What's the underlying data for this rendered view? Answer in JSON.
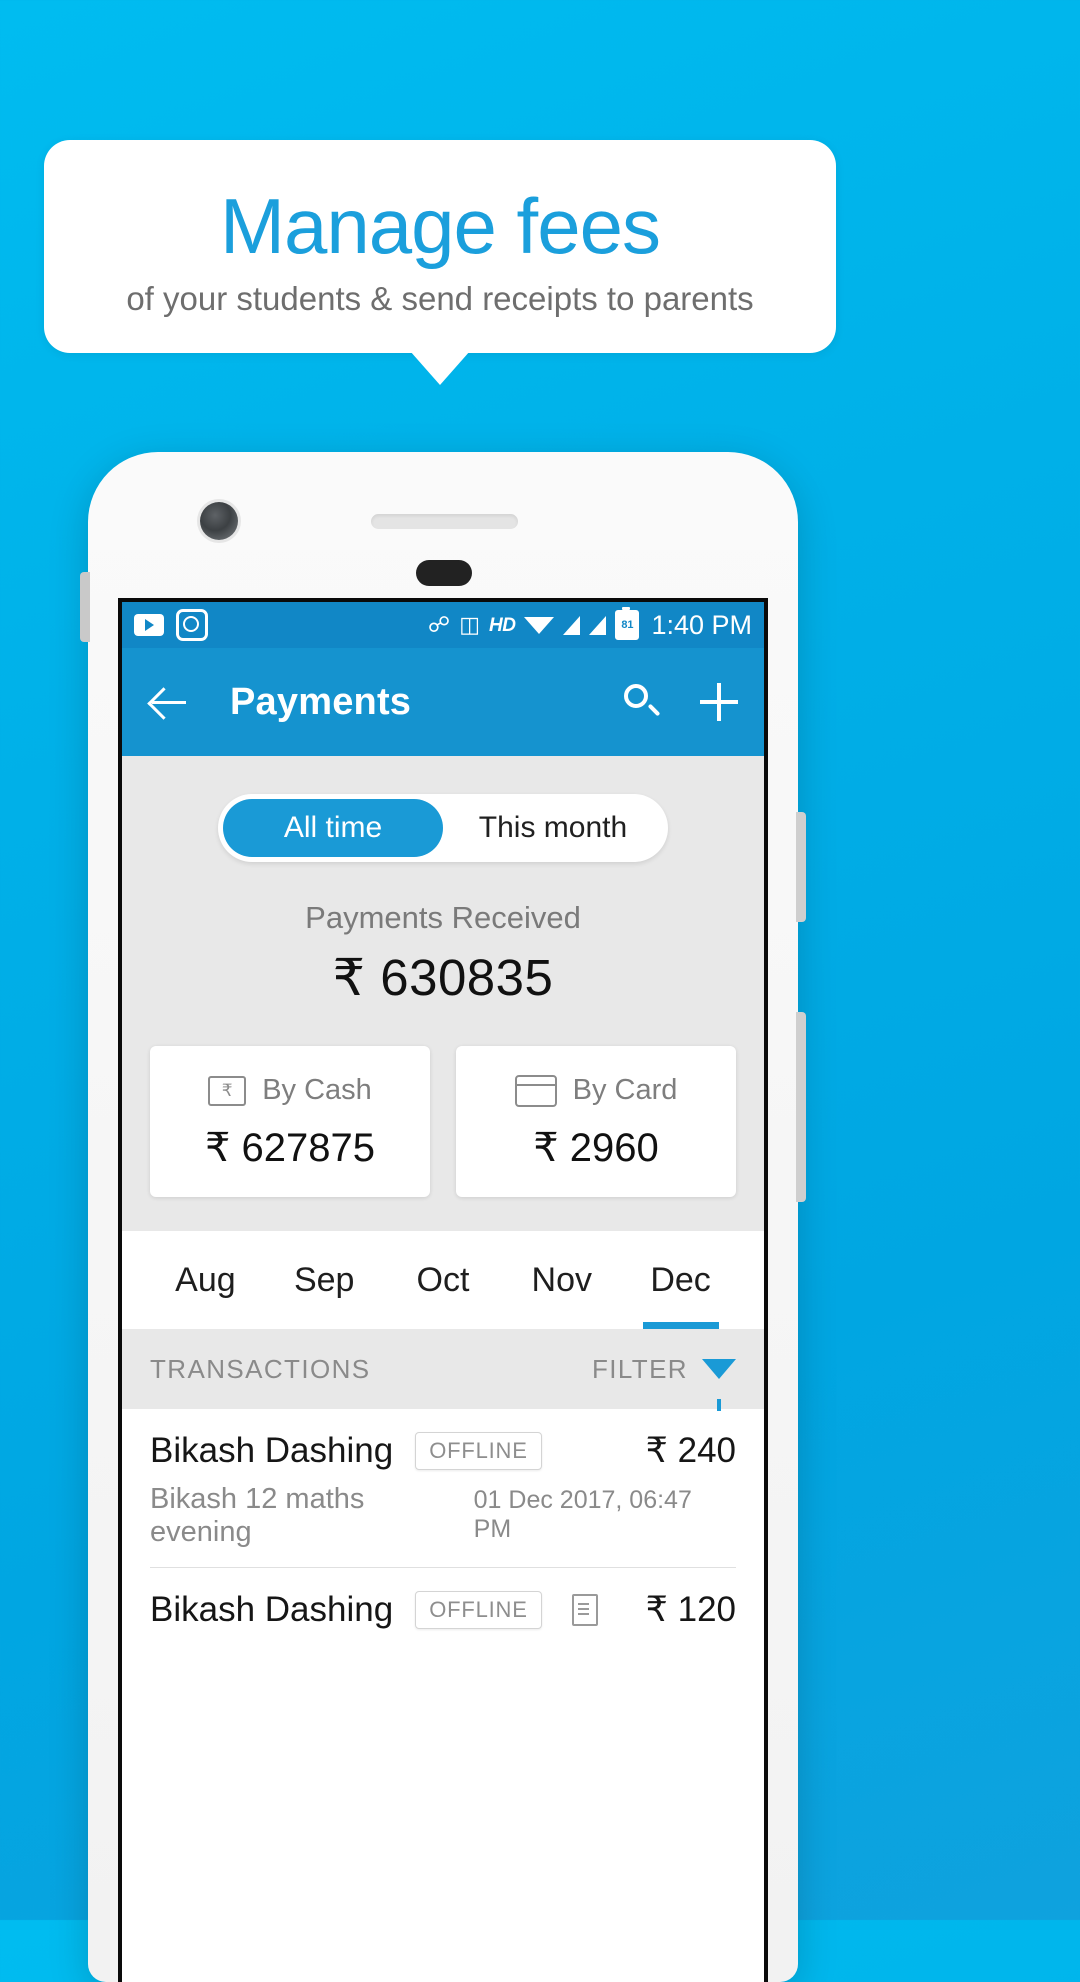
{
  "banner": {
    "title": "Manage fees",
    "subtitle": "of your students & send receipts to parents",
    "title_color": "#1b9fdc",
    "subtitle_color": "#6e6e6e",
    "background_color": "#00b0e8"
  },
  "status_bar": {
    "icons_left": [
      "youtube-icon",
      "mi-fit-icon"
    ],
    "bluetooth": "✼",
    "vibrate": "vibrate-icon",
    "hd": "HD",
    "wifi": "wifi-icon",
    "signal_1": "signal-icon",
    "signal_2": "signal-icon",
    "battery_level": "81",
    "time": "1:40 PM"
  },
  "app_bar": {
    "back": "back-arrow",
    "title": "Payments",
    "search": "search-icon",
    "add": "plus-icon",
    "color": "#1593cf"
  },
  "segment": {
    "options": [
      "All time",
      "This month"
    ],
    "selected": "All time",
    "active_color": "#1a9ad6"
  },
  "summary": {
    "received_label": "Payments Received",
    "received_amount": "₹ 630835",
    "cards": [
      {
        "icon": "cash-icon",
        "label": "By Cash",
        "amount": "₹ 627875"
      },
      {
        "icon": "credit-card-icon",
        "label": "By Card",
        "amount": "₹ 2960"
      }
    ]
  },
  "months": {
    "items": [
      "Aug",
      "Sep",
      "Oct",
      "Nov",
      "Dec"
    ],
    "selected": "Dec"
  },
  "transactions_header": {
    "title": "TRANSACTIONS",
    "filter_label": "FILTER",
    "filter_icon": "funnel-icon"
  },
  "transactions": [
    {
      "name": "Bikash Dashing",
      "badge": "OFFLINE",
      "amount": "₹ 240",
      "description": "Bikash 12 maths evening",
      "date": "01 Dec 2017, 06:47 PM",
      "has_receipt": false
    },
    {
      "name": "Bikash Dashing",
      "badge": "OFFLINE",
      "amount": "₹ 120",
      "description": "",
      "date": "",
      "has_receipt": true
    }
  ]
}
